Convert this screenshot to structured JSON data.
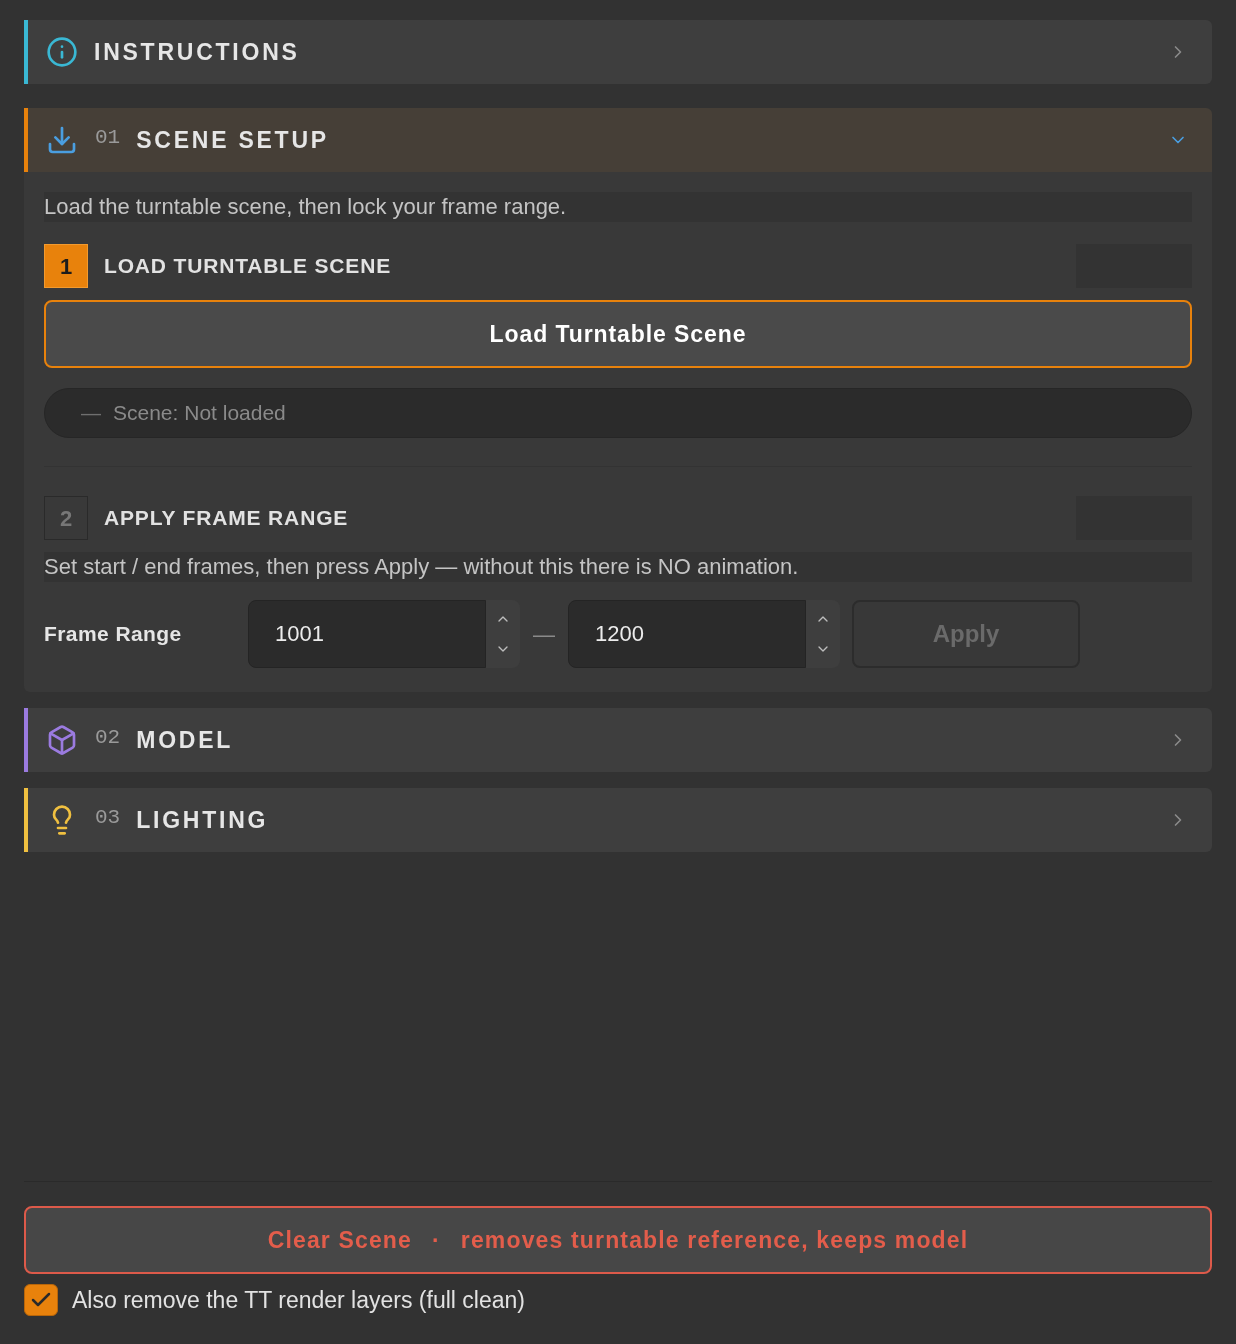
{
  "sections": [
    {
      "kind": "info",
      "title": "INSTRUCTIONS",
      "color": "#3ab8d4",
      "expanded": false
    },
    {
      "kind": "setup",
      "number": "01",
      "title": "SCENE SETUP",
      "color": "#e8820c",
      "expanded": true,
      "intro": "Load the turntable scene, then lock your frame range.",
      "steps": [
        {
          "number": "1",
          "title": "LOAD TURNTABLE SCENE",
          "active": true,
          "button": "Load Turntable Scene",
          "status": {
            "indicator": "—",
            "text": "Scene: Not loaded"
          }
        },
        {
          "number": "2",
          "title": "APPLY FRAME RANGE",
          "active": false,
          "hint": "Set start / end frames, then press Apply — without this there is NO animation.",
          "frame_range": {
            "label": "Frame Range",
            "start": "1001",
            "separator": "—",
            "end": "1200",
            "apply": {
              "label": "Apply",
              "disabled": true
            }
          }
        }
      ]
    },
    {
      "kind": "model",
      "number": "02",
      "title": "MODEL",
      "color": "#9b7be0",
      "expanded": false
    },
    {
      "kind": "lighting",
      "number": "03",
      "title": "LIGHTING",
      "color": "#f0c040",
      "expanded": false
    }
  ],
  "clear_button": {
    "label": "Clear Scene",
    "separator": "·",
    "detail": "removes turntable reference, keeps model"
  },
  "full_clean": {
    "label": "Also remove the TT render layers (full clean)",
    "checked": true
  }
}
